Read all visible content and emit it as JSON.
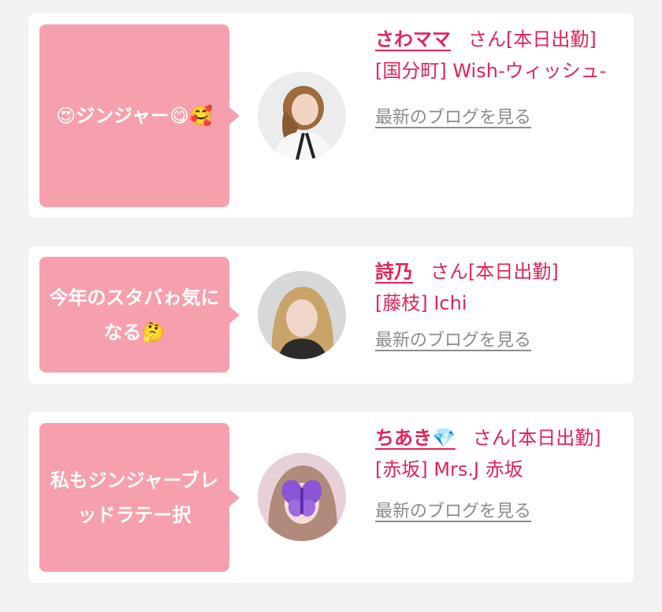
{
  "cards": [
    {
      "bubble": "😍ジンジャー😋🥰",
      "name": "さわママ",
      "status": "さん[本日出勤]",
      "shop": "[国分町] Wish-ウィッシュ-",
      "blog_link": "最新のブログを見る",
      "avatar": "profile-photo"
    },
    {
      "bubble": "今年のスタバゎ気になる🤔",
      "name": "詩乃",
      "status": "さん[本日出勤]",
      "shop": "[藤枝] Ichi",
      "blog_link": "最新のブログを見る",
      "avatar": "profile-photo"
    },
    {
      "bubble": "私もジンジャーブレッドラテー択",
      "name": "ちあき💎",
      "status": "さん[本日出勤]",
      "shop": "[赤坂] Mrs.J 赤坂",
      "blog_link": "最新のブログを見る",
      "avatar": "profile-photo"
    }
  ],
  "colors": {
    "bubble": "#f7a0ad",
    "accent": "#e1245a",
    "link_gray": "#8c8c8c",
    "background": "#f2f2f2"
  }
}
